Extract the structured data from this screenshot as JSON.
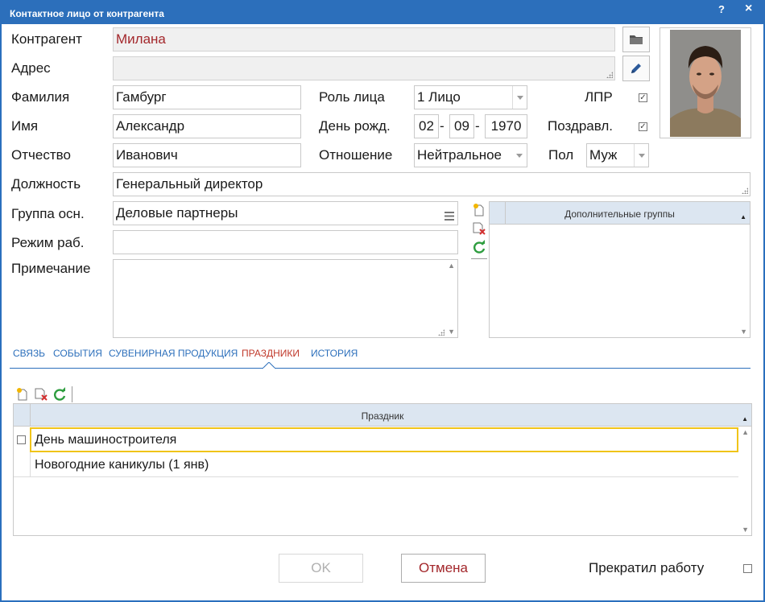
{
  "window": {
    "title": "Контактное лицо от контрагента",
    "help_label": "?",
    "close_label": "×"
  },
  "form": {
    "counterparty_label": "Контрагент",
    "counterparty_value": "Милана",
    "address_label": "Адрес",
    "address_value": "",
    "surname_label": "Фамилия",
    "surname_value": "Гамбург",
    "name_label": "Имя",
    "name_value": "Александр",
    "patronymic_label": "Отчество",
    "patronymic_value": "Иванович",
    "role_label": "Роль лица",
    "role_value": "1 Лицо",
    "birthday_label": "День рожд.",
    "birthday_day": "02",
    "birthday_month": "09",
    "birthday_year": "1970",
    "date_sep": "-",
    "relation_label": "Отношение",
    "relation_value": "Нейтральное",
    "lpr_label": "ЛПР",
    "lpr_checked": true,
    "congrats_label": "Поздравл.",
    "congrats_checked": true,
    "gender_label": "Пол",
    "gender_value": "Муж",
    "position_label": "Должность",
    "position_value": "Генеральный директор",
    "main_group_label": "Группа осн.",
    "main_group_value": "Деловые партнеры",
    "work_mode_label": "Режим раб.",
    "work_mode_value": "",
    "note_label": "Примечание",
    "note_value": "",
    "extra_groups_header": "Дополнительные группы"
  },
  "tabs": [
    {
      "label": "СВЯЗЬ",
      "active": false
    },
    {
      "label": "СОБЫТИЯ",
      "active": false
    },
    {
      "label": "СУВЕНИРНАЯ ПРОДУКЦИЯ",
      "active": false
    },
    {
      "label": "ПРАЗДНИКИ",
      "active": true
    },
    {
      "label": "ИСТОРИЯ",
      "active": false
    }
  ],
  "holidays": {
    "column_header": "Праздник",
    "rows": [
      "День машиностроителя",
      "Новогодние каникулы (1 янв)"
    ]
  },
  "footer": {
    "ok_label": "OK",
    "cancel_label": "Отмена",
    "stopped_work_label": "Прекратил работу",
    "stopped_work_checked": false
  },
  "colors": {
    "titlebar": "#2c6fbb",
    "accent_red": "#a3272b",
    "tab_active": "#c0392b",
    "grid_header": "#dce6f1",
    "selected_row_border": "#f0c419"
  },
  "icons": {
    "browse": "folder-icon",
    "edit": "pencil-icon",
    "list": "list-icon",
    "add": "add-document-icon",
    "delete": "delete-document-icon",
    "refresh": "refresh-icon"
  }
}
